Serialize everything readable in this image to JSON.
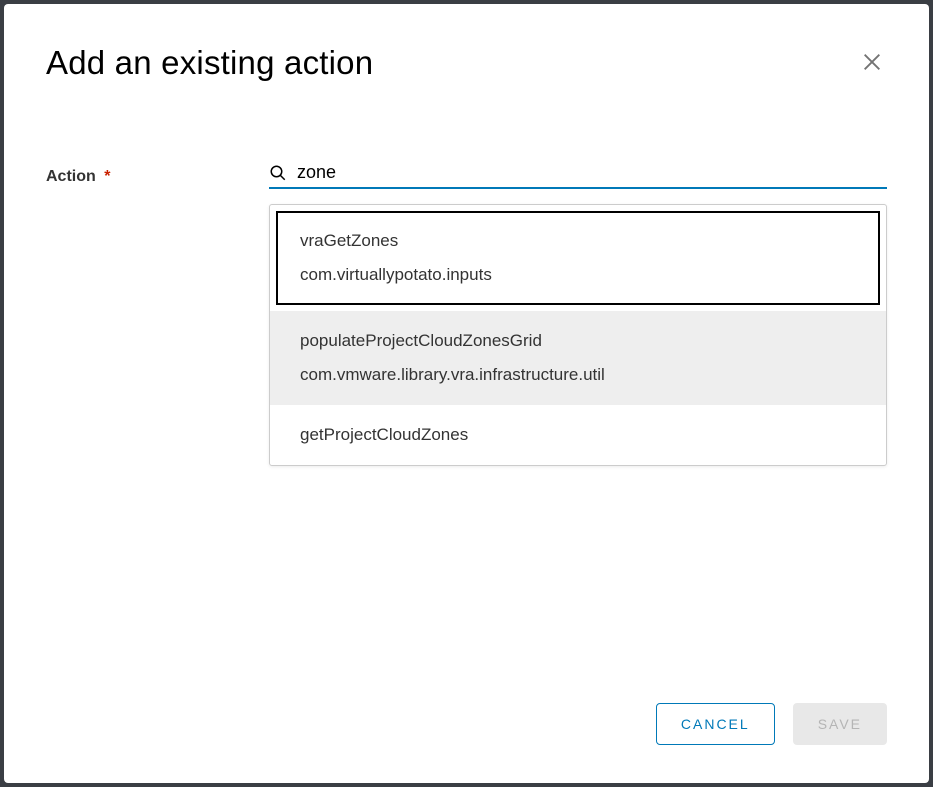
{
  "modal": {
    "title": "Add an existing action",
    "field_label": "Action",
    "required_mark": "*",
    "search_value": "zone",
    "options": [
      {
        "name": "vraGetZones",
        "namespace": "com.virtuallypotato.inputs"
      },
      {
        "name": "populateProjectCloudZonesGrid",
        "namespace": "com.vmware.library.vra.infrastructure.util"
      },
      {
        "name": "getProjectCloudZones",
        "namespace": ""
      }
    ],
    "buttons": {
      "cancel": "CANCEL",
      "save": "SAVE"
    }
  }
}
